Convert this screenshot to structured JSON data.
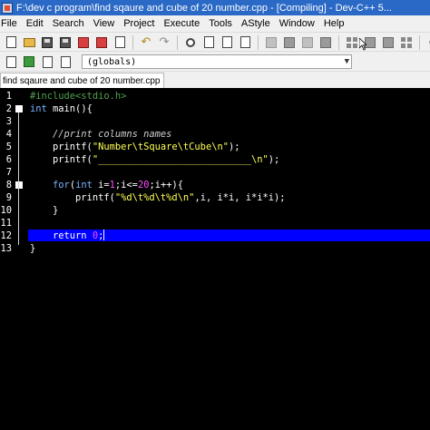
{
  "window": {
    "title": "F:\\dev c program\\find sqaure and cube of 20 number.cpp - [Compiling] - Dev-C++ 5..."
  },
  "menu": [
    "File",
    "Edit",
    "Search",
    "View",
    "Project",
    "Execute",
    "Tools",
    "AStyle",
    "Window",
    "Help"
  ],
  "toolbar": {
    "scope_combo_value": "(globals)",
    "icons": [
      "new-file-icon",
      "open-icon",
      "save-icon",
      "save-all-icon",
      "close-icon",
      "print-icon",
      "undo-icon",
      "redo-icon",
      "find-icon",
      "replace-icon",
      "goto-icon",
      "compile-icon",
      "run-icon",
      "compile-run-icon",
      "rebuild-icon",
      "debug-icon",
      "stop-icon",
      "check-icon"
    ]
  },
  "tab": {
    "label": "find sqaure and cube of 20 number.cpp"
  },
  "editor": {
    "highlighted_line": 12,
    "lines": [
      {
        "n": "1",
        "parts": [
          {
            "c": "pre",
            "t": "#include<stdio.h>"
          }
        ]
      },
      {
        "n": "2",
        "parts": [
          {
            "c": "kw",
            "t": "int"
          },
          {
            "c": "",
            "t": " main(){"
          }
        ]
      },
      {
        "n": "3",
        "parts": []
      },
      {
        "n": "4",
        "parts": [
          {
            "c": "",
            "t": "    "
          },
          {
            "c": "cmt",
            "t": "//print columns names"
          }
        ]
      },
      {
        "n": "5",
        "parts": [
          {
            "c": "",
            "t": "    printf("
          },
          {
            "c": "str",
            "t": "\"Number\\tSquare\\tCube\\n\""
          },
          {
            "c": "",
            "t": ");"
          }
        ]
      },
      {
        "n": "6",
        "parts": [
          {
            "c": "",
            "t": "    printf("
          },
          {
            "c": "str",
            "t": "\"___________________________\\n\""
          },
          {
            "c": "",
            "t": ");"
          }
        ]
      },
      {
        "n": "7",
        "parts": []
      },
      {
        "n": "8",
        "parts": [
          {
            "c": "",
            "t": "    "
          },
          {
            "c": "kw",
            "t": "for"
          },
          {
            "c": "",
            "t": "("
          },
          {
            "c": "kw",
            "t": "int"
          },
          {
            "c": "",
            "t": " i="
          },
          {
            "c": "num",
            "t": "1"
          },
          {
            "c": "",
            "t": ";i<="
          },
          {
            "c": "num",
            "t": "20"
          },
          {
            "c": "",
            "t": ";i++){"
          }
        ]
      },
      {
        "n": "9",
        "parts": [
          {
            "c": "",
            "t": "        printf("
          },
          {
            "c": "str",
            "t": "\"%d\\t%d\\t%d\\n\""
          },
          {
            "c": "",
            "t": ",i, i*i, i*i*i);"
          }
        ]
      },
      {
        "n": "10",
        "parts": [
          {
            "c": "",
            "t": "    }"
          }
        ]
      },
      {
        "n": "11",
        "parts": []
      },
      {
        "n": "12",
        "parts": [
          {
            "c": "",
            "t": "    "
          },
          {
            "c": "kw2",
            "t": "return"
          },
          {
            "c": "",
            "t": " "
          },
          {
            "c": "num",
            "t": "0"
          },
          {
            "c": "",
            "t": ";"
          }
        ]
      },
      {
        "n": "13",
        "parts": [
          {
            "c": "",
            "t": "}"
          }
        ]
      }
    ]
  },
  "colors": {
    "titlebar": "#2a69c6",
    "editor_bg": "#000000",
    "highlight": "#0000ff",
    "string": "#ffff55",
    "keyword": "#79b4ff",
    "number": "#ff4aff",
    "preprocessor": "#4ea14e"
  }
}
